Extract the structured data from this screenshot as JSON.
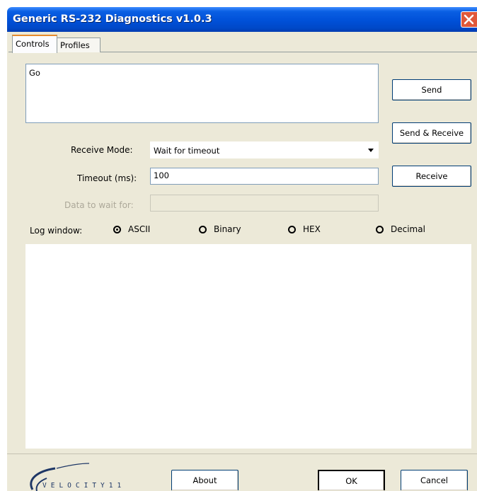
{
  "window": {
    "title": "Generic RS-232 Diagnostics v1.0.3"
  },
  "tabs": [
    {
      "label": "Controls",
      "active": true
    },
    {
      "label": "Profiles",
      "active": false
    }
  ],
  "command": {
    "value": "Go"
  },
  "buttons": {
    "send": "Send",
    "send_receive": "Send & Receive",
    "receive": "Receive",
    "about": "About",
    "ok": "OK",
    "cancel": "Cancel"
  },
  "receive_mode": {
    "label": "Receive Mode:",
    "value": "Wait for timeout"
  },
  "timeout": {
    "label": "Timeout (ms):",
    "value": "100"
  },
  "data_to_wait": {
    "label": "Data to wait for:",
    "value": ""
  },
  "log": {
    "label": "Log window:",
    "formats": [
      {
        "label": "ASCII",
        "selected": true
      },
      {
        "label": "Binary",
        "selected": false
      },
      {
        "label": "HEX",
        "selected": false
      },
      {
        "label": "Decimal",
        "selected": false
      }
    ]
  },
  "logo": {
    "text": "VELOCITY11"
  },
  "colors": {
    "titlebar": "#0050d8",
    "dialog_bg": "#ece9d8",
    "close": "#e0583a"
  }
}
